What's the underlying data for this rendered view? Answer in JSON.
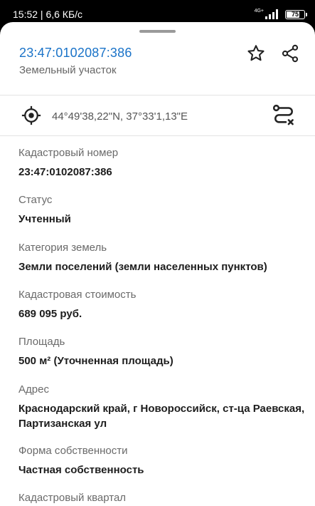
{
  "status_bar": {
    "time": "15:52 | 6,6 КБ/с",
    "network": "4G+",
    "battery": "75",
    "battery_level": 0.75
  },
  "header": {
    "cadastral_number": "23:47:0102087:386",
    "object_type": "Земельный участок",
    "favorite_icon": "star-outline-icon",
    "share_icon": "share-icon"
  },
  "location": {
    "coordinates": "44°49'38,22\"N, 37°33'1,13\"E",
    "locate_icon": "crosshair-target-icon",
    "route_icon": "route-icon"
  },
  "fields": [
    {
      "label": "Кадастровый номер",
      "value": "23:47:0102087:386"
    },
    {
      "label": "Статус",
      "value": "Учтенный"
    },
    {
      "label": "Категория земель",
      "value": "Земли поселений (земли населенных пунктов)"
    },
    {
      "label": "Кадастровая стоимость",
      "value": "689 095 руб."
    },
    {
      "label": "Площадь",
      "value": "500 м² (Уточненная площадь)"
    },
    {
      "label": "Адрес",
      "value": "Краснодарский край, г Новороссийск, ст-ца Раевская, Партизанская ул"
    },
    {
      "label": "Форма собственности",
      "value": "Частная собственность"
    },
    {
      "label": "Кадастровый квартал",
      "value": ""
    }
  ],
  "colors": {
    "accent": "#1a73c8",
    "label": "#6a6a6a",
    "value": "#1d1d1d"
  }
}
